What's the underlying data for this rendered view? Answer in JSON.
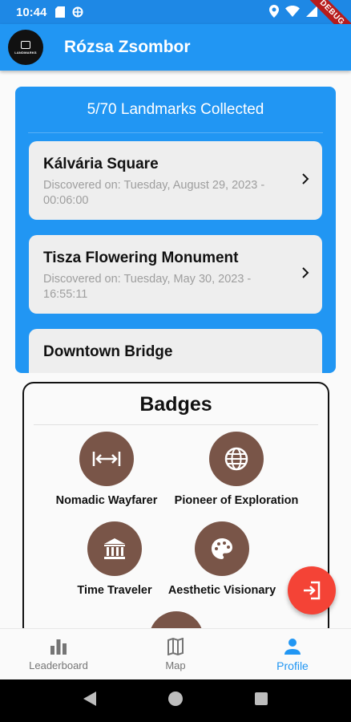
{
  "status_bar": {
    "time": "10:44",
    "debug_label": "DEBUG"
  },
  "app_bar": {
    "logo_text": "LANDMARKS",
    "title": "Rózsa Zsombor"
  },
  "landmarks": {
    "header": "5/70 Landmarks Collected",
    "items": [
      {
        "name": "Kálvária Square",
        "date_line1": "Discovered on: Tuesday, August 29, 2023 -",
        "date_line2": "00:06:00"
      },
      {
        "name": "Tisza Flowering Monument",
        "date_line1": "Discovered on: Tuesday, May 30, 2023 -",
        "date_line2": "16:55:11"
      },
      {
        "name": "Downtown Bridge",
        "date_line1": "",
        "date_line2": ""
      }
    ]
  },
  "badges": {
    "title": "Badges",
    "items": [
      {
        "label": "Nomadic Wayfarer",
        "icon": "horizontal-arrows-icon"
      },
      {
        "label": "Pioneer of Exploration",
        "icon": "globe-icon"
      },
      {
        "label": "Time Traveler",
        "icon": "museum-icon"
      },
      {
        "label": "Aesthetic Visionary",
        "icon": "palette-icon"
      }
    ]
  },
  "fab": {
    "icon": "logout-icon"
  },
  "bottom_nav": {
    "items": [
      {
        "label": "Leaderboard",
        "icon": "bar-chart-icon"
      },
      {
        "label": "Map",
        "icon": "map-icon"
      },
      {
        "label": "Profile",
        "icon": "person-icon"
      }
    ],
    "active": "Profile"
  },
  "colors": {
    "primary": "#2196f3",
    "badge": "#795548",
    "fab": "#f44336"
  }
}
